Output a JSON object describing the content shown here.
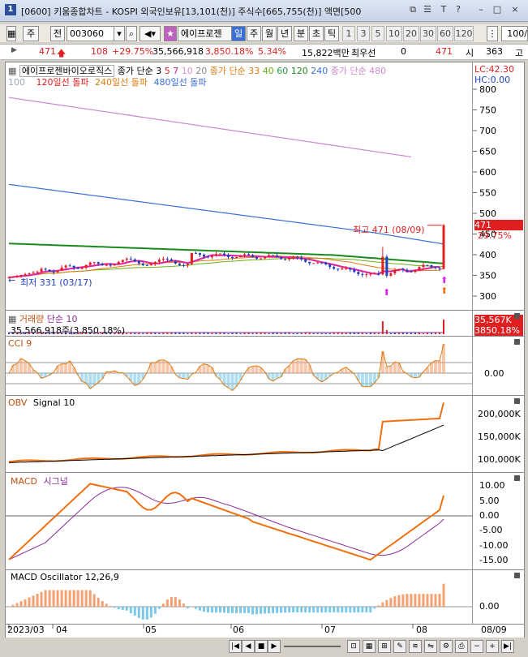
{
  "window": {
    "icon_label": "1",
    "title": "[0600] 키움종합차트 - KOSPI 외국인보유[13,101(천)] 주식수[665,755(천)] 액면[500",
    "btn_icons": [
      "restore-icon",
      "menu-icon",
      "text-icon",
      "help-icon",
      "minimize-icon",
      "maximize-icon",
      "close-icon"
    ],
    "btn_glyphs": [
      "⧉",
      "☰",
      "T",
      "?",
      "–",
      "□",
      "×"
    ]
  },
  "toolbar": {
    "period_label": "주",
    "prev_label": "전",
    "code_value": "003060",
    "stock_name": "에이프로젠",
    "tabs": [
      "일",
      "주",
      "월",
      "년",
      "분",
      "초",
      "틱"
    ],
    "numbers": [
      "1",
      "3",
      "5",
      "10",
      "20",
      "30",
      "60",
      "120"
    ],
    "count_value": "100/"
  },
  "price_info": {
    "price": "471",
    "change": "108",
    "change_pct": "+29.75%",
    "volume": "35,566,918",
    "vol_ratio": "3,850.18%",
    "rate": "5.34%",
    "amount": "15,822백만",
    "best_label": "최우선",
    "best_value": "0",
    "price2": "471",
    "open_label": "시",
    "open_value": "363",
    "high_label": "고"
  },
  "main_panel": {
    "title": "에이프로젠바이오로직스",
    "ma_label": "종가 단순 3",
    "ma_periods": [
      "5",
      "7",
      "10",
      "20"
    ],
    "ma2_label": "종가 단순 33",
    "ma2_periods": [
      "40",
      "60",
      "120",
      "240"
    ],
    "ma3_label": "종가 단순 480",
    "legend_line2": [
      "100",
      "120일선 돌파",
      "240일선 돌파",
      "480일선 돌파"
    ],
    "lc": "LC:42.30",
    "hc": "HC:0.00",
    "y_ticks": [
      "800",
      "750",
      "700",
      "650",
      "600",
      "550",
      "500",
      "450",
      "400",
      "350",
      "300"
    ],
    "high_note": "최고 471 (08/09)",
    "low_note": "최저 331 (03/17)",
    "price_tag": "471",
    "pct_tag": "29.75%"
  },
  "volume_panel": {
    "title": "거래량",
    "sub": "단순 10",
    "value_text": "35,566,918주(3,850.18%)",
    "tag1": "35,567K",
    "tag2": "3850.18%"
  },
  "cci_panel": {
    "title": "CCI 9",
    "zero": "0.00"
  },
  "obv_panel": {
    "title": "OBV",
    "signal": "Signal 10",
    "ticks": [
      "200,000K",
      "150,000K",
      "100,000K"
    ]
  },
  "macd_panel": {
    "title": "MACD",
    "signal": "시그널",
    "ticks": [
      "10.00",
      "5.00",
      "0.00",
      "-5.00",
      "-10.00",
      "-15.00"
    ]
  },
  "osc_panel": {
    "title": "MACD Oscillator 12,26,9",
    "zero": "0.00"
  },
  "x_axis": {
    "labels": [
      "2023/03",
      "04",
      "05",
      "06",
      "07",
      "08"
    ],
    "right_label": "08/09"
  },
  "colors": {
    "up": "#e02020",
    "down": "#1f3fbf",
    "ma480": "#cc88cc",
    "ma240": "#3a6fd8",
    "ma120": "#1a8a1a",
    "macd": "#f07010",
    "signal": "#8a2a9a",
    "cci_up": "#f4a070",
    "cci_dn": "#7ac8e8"
  }
}
